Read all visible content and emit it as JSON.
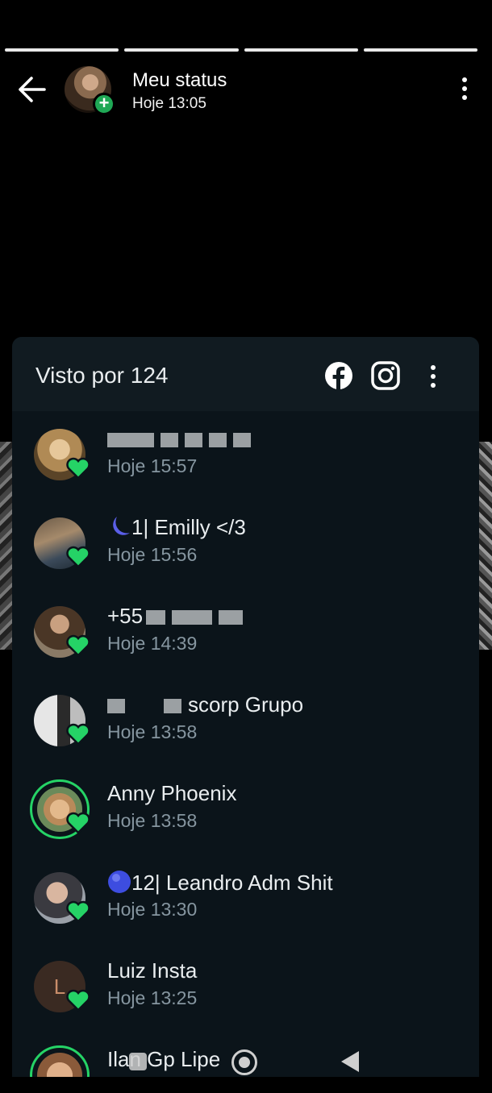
{
  "header": {
    "title": "Meu status",
    "subtitle": "Hoje 13:05"
  },
  "sheet": {
    "viewed_label": "Visto por 124"
  },
  "viewers": [
    {
      "name": "",
      "time": "Hoje 15:57"
    },
    {
      "name": "1| Emilly </3",
      "time": "Hoje 15:56"
    },
    {
      "name": "+55",
      "time": "Hoje 14:39"
    },
    {
      "name": "scorp Grupo",
      "time": "Hoje 13:58"
    },
    {
      "name": "Anny Phoenix",
      "time": "Hoje 13:58"
    },
    {
      "name": "12| Leandro Adm Shit",
      "time": "Hoje 13:30"
    },
    {
      "name": "Luiz Insta",
      "time": "Hoje 13:25",
      "initial": "L"
    },
    {
      "name": "Ilan Gp Lipe",
      "time": ""
    }
  ],
  "colors": {
    "accent": "#25d366",
    "sheet_bg": "#0b141a"
  }
}
